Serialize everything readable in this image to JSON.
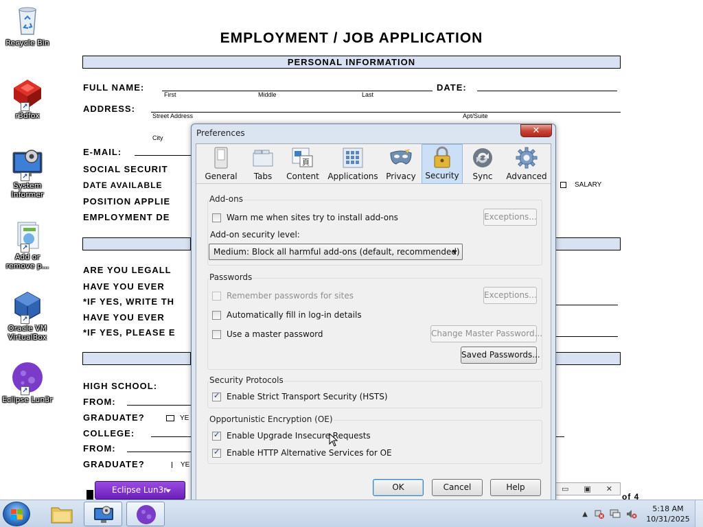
{
  "document": {
    "title": "EMPLOYMENT / JOB APPLICATION",
    "section_personal": "PERSONAL INFORMATION",
    "full_name_label": "FULL NAME:",
    "date_label": "DATE:",
    "name_parts": [
      "First",
      "Middle",
      "Last"
    ],
    "address_label": "ADDRESS:",
    "street_label": "Street Address",
    "apt_label": "Apt/Suite",
    "city_label": "City",
    "email_label": "E-MAIL:",
    "ssn_label": "SOCIAL SECURIT",
    "date_available_label": "DATE AVAILABLE",
    "salary_label": "SALARY",
    "position_label": "POSITION APPLIE",
    "employment_label": "EMPLOYMENT DE",
    "q1": "ARE YOU LEGALL",
    "q2": "HAVE YOU EVER",
    "q3": "*IF YES, WRITE TH",
    "q4": "HAVE YOU EVER",
    "q5": "*IF YES, PLEASE E",
    "high_school_label": "HIGH SCHOOL:",
    "from_label": "FROM:",
    "graduate_label": "GRADUATE?",
    "yes_label": "YE",
    "college_label": "COLLEGE:",
    "from_label_2": "FROM:",
    "graduate_label_2": "GRADUATE?",
    "yes_label_2": "YE",
    "page_suffix": "of 4"
  },
  "desktop_icons": [
    {
      "label": "Recycle Bin",
      "icon": "recycle-bin-icon"
    },
    {
      "label": "r3dfox",
      "icon": "r3dfox-icon"
    },
    {
      "label": "System Informer",
      "icon": "system-informer-icon"
    },
    {
      "label": "Add or remove p...",
      "icon": "add-remove-programs-icon"
    },
    {
      "label": "Oracle VM VirtualBox",
      "icon": "virtualbox-icon"
    },
    {
      "label": "Eclipse Lun3r",
      "icon": "eclipse-lun3r-icon"
    }
  ],
  "dialog": {
    "title": "Preferences",
    "close_label": "✕",
    "tabs": [
      {
        "label": "General",
        "icon": "general-icon"
      },
      {
        "label": "Tabs",
        "icon": "tabs-icon"
      },
      {
        "label": "Content",
        "icon": "content-icon"
      },
      {
        "label": "Applications",
        "icon": "applications-icon"
      },
      {
        "label": "Privacy",
        "icon": "privacy-mask-icon"
      },
      {
        "label": "Security",
        "icon": "padlock-icon"
      },
      {
        "label": "Sync",
        "icon": "sync-icon"
      },
      {
        "label": "Advanced",
        "icon": "gear-icon"
      }
    ],
    "active_tab": "Security",
    "addons": {
      "title": "Add-ons",
      "warn_label": "Warn me when sites try to install add-ons",
      "warn_checked": false,
      "exceptions_label": "Exceptions...",
      "security_level_label": "Add-on security level:",
      "security_level_value": "Medium: Block all harmful add-ons (default, recommended)"
    },
    "passwords": {
      "title": "Passwords",
      "remember_label": "Remember passwords for sites",
      "remember_checked": false,
      "exceptions_label": "Exceptions...",
      "autofill_label": "Automatically fill in log-in details",
      "autofill_checked": false,
      "master_label": "Use a master password",
      "master_checked": false,
      "change_master_label": "Change Master Password...",
      "saved_passwords_label": "Saved Passwords..."
    },
    "protocols": {
      "title": "Security Protocols",
      "hsts_label": "Enable Strict Transport Security (HSTS)",
      "hsts_checked": true
    },
    "oe": {
      "title": "Opportunistic Encryption (OE)",
      "upgrade_label": "Enable Upgrade Insecure Requests",
      "upgrade_checked": true,
      "alt_services_label": "Enable HTTP Alternative Services for OE",
      "alt_services_checked": true
    },
    "ok_label": "OK",
    "cancel_label": "Cancel",
    "help_label": "Help"
  },
  "floating_button": {
    "label": "Eclipse Lun3r"
  },
  "taskbar": {
    "time": "5:18 AM",
    "date": "10/31/2025"
  }
}
